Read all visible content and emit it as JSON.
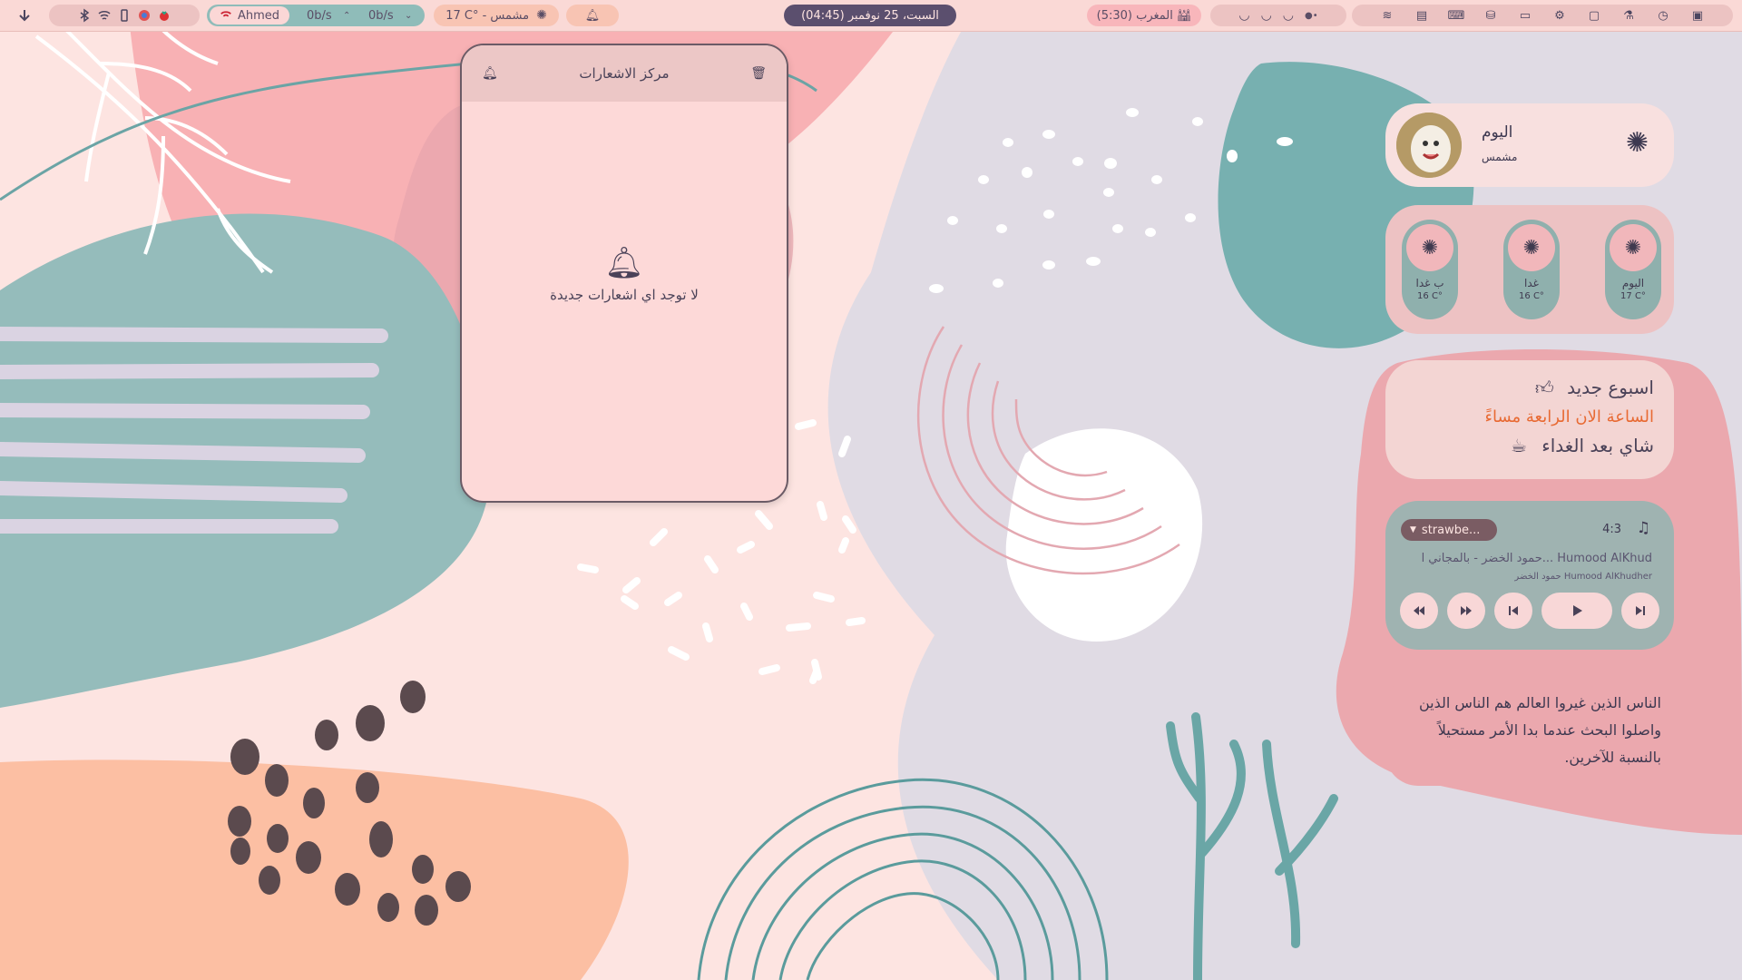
{
  "colors": {
    "accent": "#5b4f6e",
    "pink": "#f2a8b0",
    "teal": "#7aadaa",
    "cream": "#fde4e1",
    "orange": "#e86a33"
  },
  "topbar": {
    "user": "Ahmed",
    "net_up": "0b/s",
    "net_down": "0b/s",
    "weather": "17 C° - مشمس",
    "clock": "(04:45) السبت، 25 نوفمبر",
    "prayer": "المغرب (5:30)",
    "icons": [
      "download-icon",
      "bluetooth-icon",
      "wifi-icon",
      "battery-icon",
      "chrome-icon",
      "tomato-icon",
      "bell-icon",
      "mosque-icon",
      "layers-icon",
      "files-icon",
      "terminal-icon"
    ]
  },
  "notification_center": {
    "title": "مركز الاشعارات",
    "empty_text": "لا توجد اي اشعارات جديدة"
  },
  "weather_widget": {
    "title": "اليوم",
    "condition": "مشمس"
  },
  "forecast": [
    {
      "name": "اليوم",
      "temp": "17 C°"
    },
    {
      "name": "غدا",
      "temp": "16 C°"
    },
    {
      "name": "ب غدا",
      "temp": "16 C°"
    }
  ],
  "motd": {
    "line1": "اسبوع جديد",
    "line2": "الساعة الان الرابعة مساءً",
    "line3": "شاي بعد الغداء"
  },
  "music": {
    "player": "strawbe...",
    "ratio": "4:3",
    "title": "حمود الخضر - بالمجاني ا... Humood AlKhud",
    "artist": "حمود الخضر Humood AlKhudher"
  },
  "quote": {
    "text": "الناس الذين غيروا العالم هم الناس الذين واصلوا البحث عندما بدا الأمر مستحيلاً بالنسبة للآخرين."
  }
}
